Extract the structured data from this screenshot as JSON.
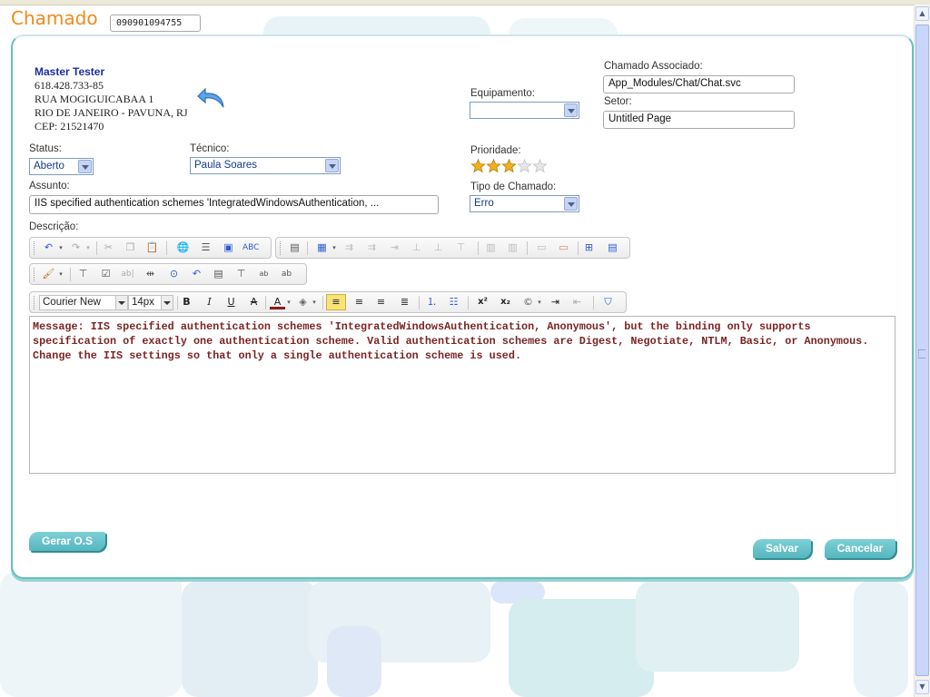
{
  "header": {
    "title": "Chamado",
    "ticket_number": "090901094755"
  },
  "client": {
    "name": "Master Tester",
    "document": "618.428.733-85",
    "street": "RUA MOGIGUICABAA 1",
    "city": "RIO DE JANEIRO - PAVUNA, RJ",
    "cep": "CEP: 21521470"
  },
  "fields": {
    "equipamento_label": "Equipamento:",
    "equipamento_value": "",
    "chamado_associado_label": "Chamado Associado:",
    "chamado_associado_value": "App_Modules/Chat/Chat.svc",
    "setor_label": "Setor:",
    "setor_value": "Untitled Page",
    "status_label": "Status:",
    "status_value": "Aberto",
    "tecnico_label": "Técnico:",
    "tecnico_value": "Paula Soares",
    "prioridade_label": "Prioridade:",
    "prioridade_rating": 3,
    "prioridade_max": 5,
    "assunto_label": "Assunto:",
    "assunto_value": "IIS specified authentication schemes 'IntegratedWindowsAuthentication, ...",
    "tipo_label": "Tipo de Chamado:",
    "tipo_value": "Erro",
    "descricao_label": "Descrição:"
  },
  "editor": {
    "font_family": "Courier New",
    "font_size": "14px",
    "content": "Message: IIS specified authentication schemes 'IntegratedWindowsAuthentication, Anonymous', but the binding only supports specification of exactly one authentication scheme. Valid authentication schemes are Digest, Negotiate, NTLM, Basic, or Anonymous. Change the IIS settings so that only a single authentication scheme is used."
  },
  "buttons": {
    "gerar_os": "Gerar O.S",
    "salvar": "Salvar",
    "cancelar": "Cancelar"
  },
  "colors": {
    "title": "#f08a1c",
    "accent": "#66bfc3",
    "button": "#56b6be",
    "editor_text": "#7a2424",
    "star": "#f2b01e"
  },
  "icons": {
    "toolbar1": [
      "undo-icon",
      "redo-icon",
      "cut-icon",
      "copy-icon",
      "paste-icon",
      "hyperlink-icon",
      "list-icon",
      "image-icon",
      "spellcheck-icon",
      "template-icon",
      "table-icon",
      "insert-row-icon",
      "insert-column-icon",
      "delete-icon",
      "merge-icon",
      "split-icon",
      "cell-props-icon",
      "table-props-icon",
      "insert-layer-icon"
    ],
    "toolbar2": [
      "format-painter-icon",
      "form-icon",
      "checkbox-icon",
      "textbox-icon",
      "hidden-field-icon",
      "radio-icon",
      "undo-form-icon",
      "select-icon",
      "button-icon",
      "textarea-icon",
      "label-icon"
    ],
    "toolbar3": [
      "bold-icon",
      "italic-icon",
      "underline-icon",
      "strikethrough-icon",
      "font-color-icon",
      "highlight-icon",
      "align-left-icon",
      "align-center-icon",
      "align-right-icon",
      "justify-icon",
      "numbered-list-icon",
      "bullet-list-icon",
      "superscript-icon",
      "subscript-icon",
      "symbol-icon",
      "indent-icon",
      "outdent-icon",
      "clean-icon"
    ]
  }
}
